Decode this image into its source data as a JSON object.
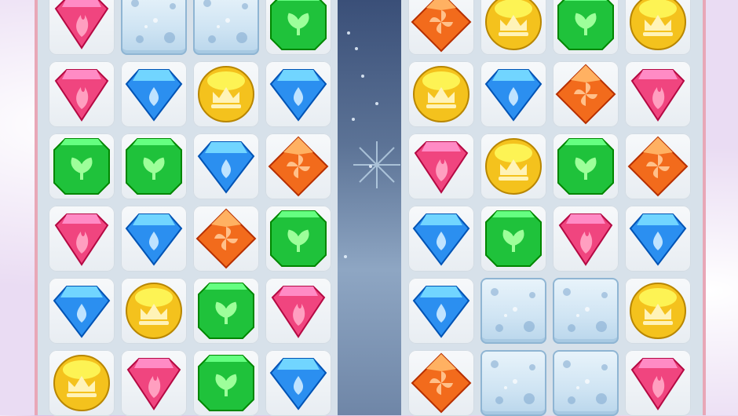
{
  "game": {
    "boards": [
      {
        "name": "left",
        "rows": [
          [
            "ruby",
            "ice",
            "ice",
            "emerald"
          ],
          [
            "ruby",
            "sapphire",
            "topaz",
            "sapphire"
          ],
          [
            "emerald",
            "emerald",
            "sapphire",
            "amber"
          ],
          [
            "ruby",
            "sapphire",
            "amber",
            "emerald"
          ],
          [
            "sapphire",
            "topaz",
            "emerald",
            "ruby"
          ],
          [
            "topaz",
            "ruby",
            "emerald",
            "sapphire"
          ]
        ]
      },
      {
        "name": "right",
        "rows": [
          [
            "amber",
            "topaz",
            "emerald",
            "topaz"
          ],
          [
            "topaz",
            "sapphire",
            "amber",
            "ruby"
          ],
          [
            "ruby",
            "topaz",
            "emerald",
            "amber"
          ],
          [
            "sapphire",
            "emerald",
            "ruby",
            "sapphire"
          ],
          [
            "sapphire",
            "ice",
            "ice",
            "topaz"
          ],
          [
            "amber",
            "ice",
            "ice",
            "ruby"
          ]
        ]
      }
    ],
    "gem_colors": {
      "ruby": "#f0457f",
      "sapphire": "#2b8ff0",
      "emerald": "#1fc23b",
      "topaz": "#f4c21d",
      "amber": "#f26b1c",
      "ice": "#cfe4f3"
    },
    "icons": {
      "ruby": "flame-icon",
      "sapphire": "droplet-icon",
      "emerald": "leaf-icon",
      "topaz": "crown-icon",
      "amber": "pinwheel-icon",
      "ice": "flower-icon"
    }
  }
}
